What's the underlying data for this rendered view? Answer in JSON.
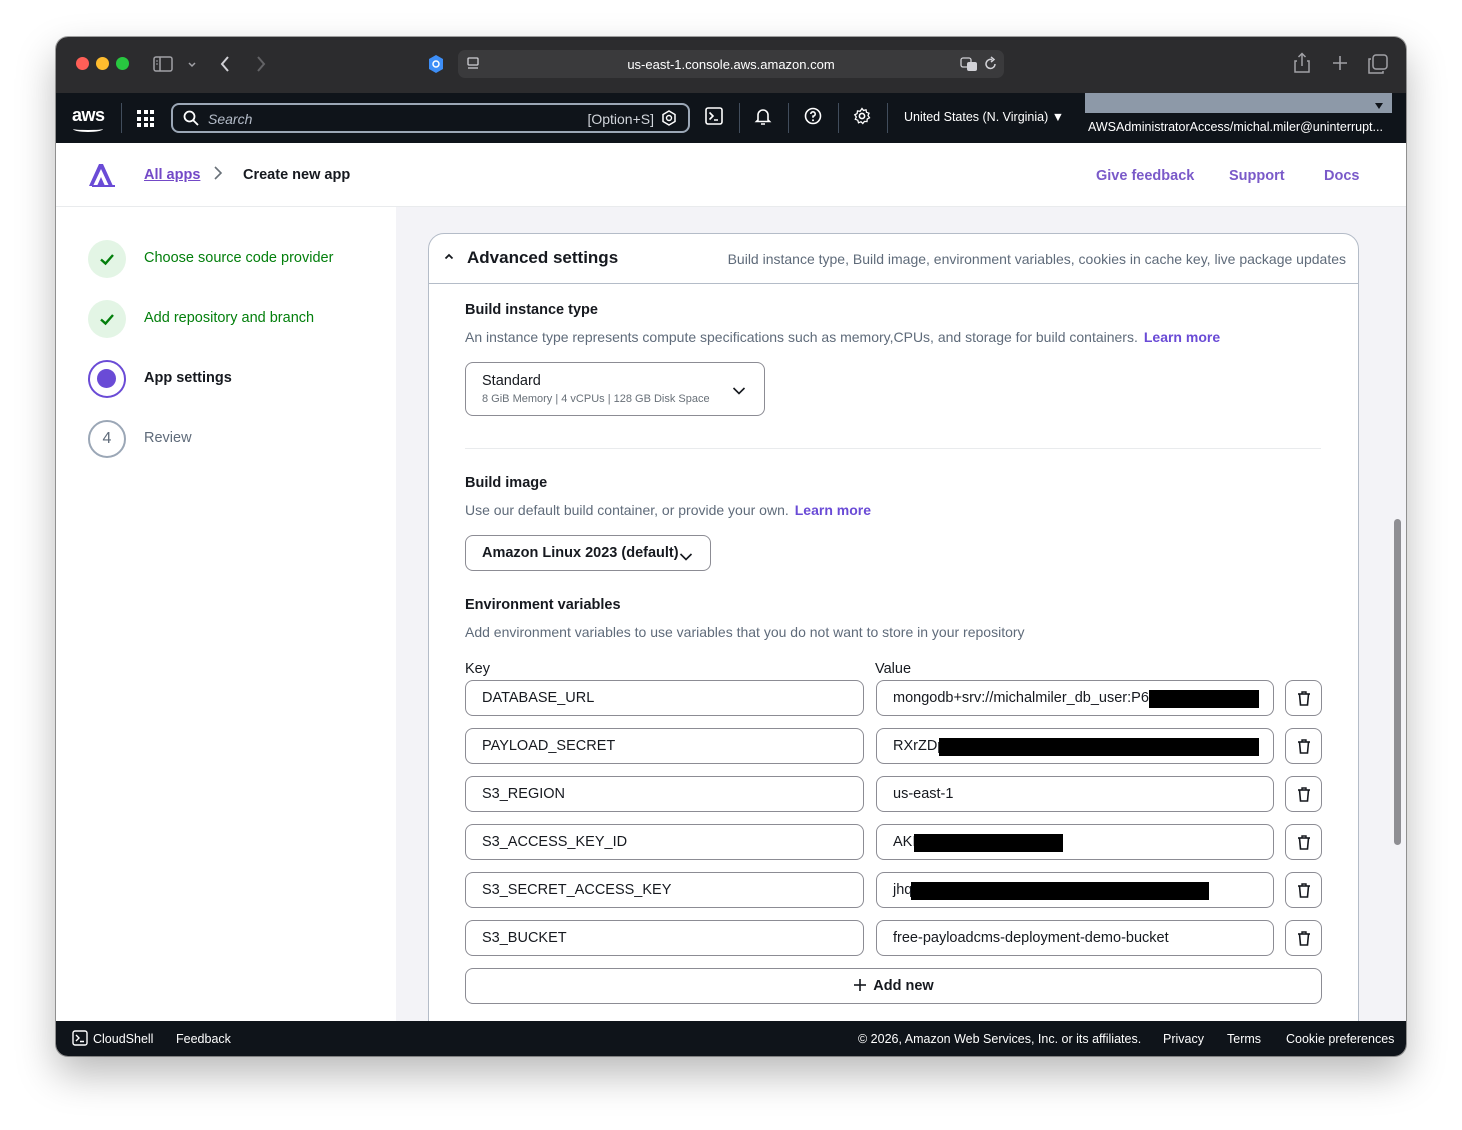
{
  "browser": {
    "url": "us-east-1.console.aws.amazon.com"
  },
  "aws_nav": {
    "logo": "aws",
    "search_placeholder": "Search",
    "search_shortcut": "[Option+S]",
    "region": "United States (N. Virginia) ▼",
    "account": "AWSAdministratorAccess/michal.miler@uninterrupt..."
  },
  "app_header": {
    "breadcrumb_link": "All apps",
    "breadcrumb_current": "Create new app",
    "links": [
      "Give feedback",
      "Support",
      "Docs"
    ]
  },
  "steps": [
    {
      "label": "Choose source code provider",
      "state": "done"
    },
    {
      "label": "Add repository and branch",
      "state": "done"
    },
    {
      "label": "App settings",
      "state": "current"
    },
    {
      "label": "Review",
      "state": "pending",
      "number": "4"
    }
  ],
  "advanced": {
    "title": "Advanced settings",
    "description": "Build instance type, Build image, environment variables, cookies in cache key, live package updates",
    "build_instance": {
      "title": "Build instance type",
      "description": "An instance type represents compute specifications such as memory,CPUs, and storage for build containers.",
      "learn_more": "Learn more",
      "selected": "Standard",
      "selected_detail": "8 GiB Memory | 4 vCPUs | 128 GB Disk Space"
    },
    "build_image": {
      "title": "Build image",
      "description": "Use our default build container, or provide your own.",
      "learn_more": "Learn more",
      "selected": "Amazon Linux 2023 (default)"
    },
    "env": {
      "title": "Environment variables",
      "description": "Add environment variables to use variables that you do not want to store in your repository",
      "key_label": "Key",
      "value_label": "Value",
      "rows": [
        {
          "key": "DATABASE_URL",
          "value": "mongodb+srv://michalmiler_db_user:P6",
          "redacted": true
        },
        {
          "key": "PAYLOAD_SECRET",
          "value": "RXrZDp",
          "redacted": true
        },
        {
          "key": "S3_REGION",
          "value": "us-east-1",
          "redacted": false
        },
        {
          "key": "S3_ACCESS_KEY_ID",
          "value": "AKI",
          "redacted": true
        },
        {
          "key": "S3_SECRET_ACCESS_KEY",
          "value": "jhq",
          "redacted": true
        },
        {
          "key": "S3_BUCKET",
          "value": "free-payloadcms-deployment-demo-bucket",
          "redacted": false
        }
      ],
      "add_label": "Add new"
    }
  },
  "footer": {
    "cloudshell": "CloudShell",
    "feedback": "Feedback",
    "copyright": "© 2026, Amazon Web Services, Inc. or its affiliates.",
    "privacy": "Privacy",
    "terms": "Terms",
    "cookies": "Cookie preferences"
  },
  "colors": {
    "accent": "#6a4bd6",
    "link": "#7349c7",
    "success": "#037f0c",
    "nav_bg": "#0f141a"
  }
}
